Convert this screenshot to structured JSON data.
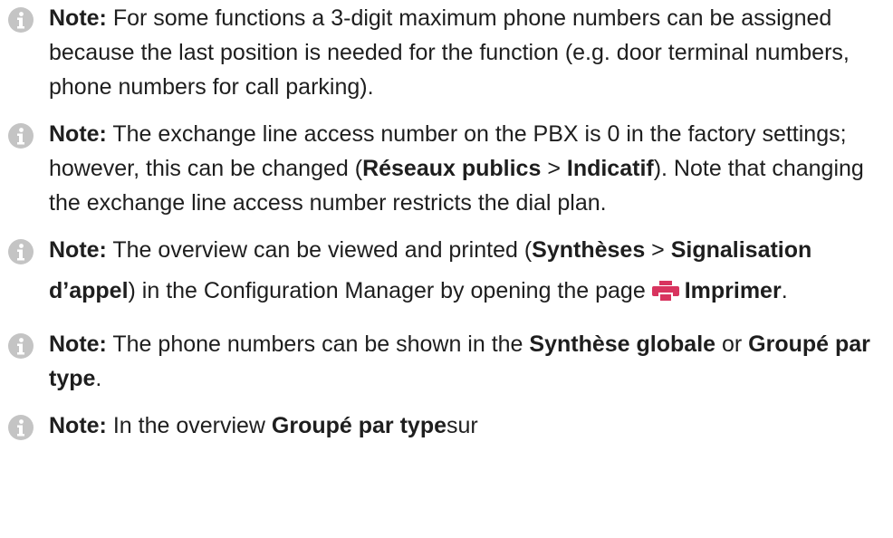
{
  "notes": [
    {
      "label": "Note:",
      "text_a": " For some functions a 3-digit maximum phone numbers can be assigned because the last position is needed for the function (e.g. door terminal numbers, phone numbers for call parking)."
    },
    {
      "label": "Note:",
      "text_a": " The exchange line access number on the PBX is 0 in the factory settings; however, this can be changed (",
      "bold_1": "Réseaux publics",
      "sep": " > ",
      "bold_2": "Indicatif",
      "text_b": "). Note that changing the exchange line access number restricts the dial plan."
    },
    {
      "label": "Note:",
      "text_a": " The overview can be viewed and printed (",
      "bold_1": "Synthèses",
      "sep": " > ",
      "bold_2": "Signalisation d’appel",
      "text_b": ") in the Configuration Manager by opening the page ",
      "print_label": "Imprimer",
      "text_c": "."
    },
    {
      "label": "Note:",
      "text_a": " The phone numbers can be shown in the ",
      "bold_1": "Synthèse globale",
      "text_b": " or ",
      "bold_2": "Groupé par type",
      "text_c": "."
    },
    {
      "label": "Note:",
      "text_a": " In the overview ",
      "bold_1": "Groupé par type",
      "text_b": "sur"
    }
  ],
  "icons": {
    "info": "info-icon",
    "printer": "printer-icon"
  },
  "colors": {
    "info_icon": "#c4c4c4",
    "printer_icon": "#d8345f",
    "text": "#1e1e1e"
  }
}
